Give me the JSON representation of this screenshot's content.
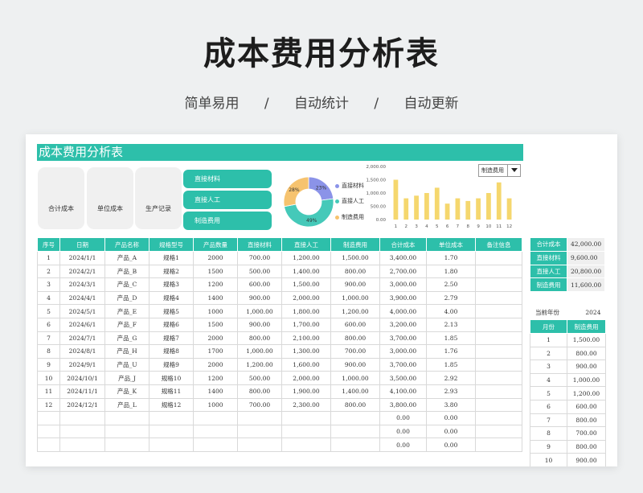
{
  "page": {
    "headline": "成本费用分析表",
    "tags": [
      "简单易用",
      "/",
      "自动统计",
      "/",
      "自动更新"
    ]
  },
  "sheet": {
    "banner_title": "成本费用分析表",
    "cards": [
      "合计成本",
      "单位成本",
      "生产记录"
    ],
    "category_buttons": [
      "直接材料",
      "直接人工",
      "制造费用"
    ]
  },
  "donut": {
    "slices": [
      {
        "label": "直接材料",
        "percent": 23,
        "value_text": "23%",
        "color": "#8b93e8"
      },
      {
        "label": "直接人工",
        "percent": 49,
        "value_text": "49%",
        "color": "#45c9b9"
      },
      {
        "label": "制造费用",
        "percent": 28,
        "value_text": "28%",
        "color": "#f6c36f"
      }
    ]
  },
  "chart_data": {
    "type": "bar",
    "categories": [
      "1",
      "2",
      "3",
      "4",
      "5",
      "6",
      "7",
      "8",
      "9",
      "10",
      "11",
      "12"
    ],
    "values": [
      1500,
      800,
      900,
      1000,
      1200,
      600,
      800,
      700,
      800,
      1000,
      1400,
      800
    ],
    "ylim": [
      0,
      2000
    ],
    "yticks": [
      "2,000.00",
      "1,500.00",
      "1,000.00",
      "500.00",
      "0.00"
    ],
    "bar_color": "#f5d76e",
    "selector_value": "制造费用",
    "title": "",
    "xlabel": "",
    "ylabel": ""
  },
  "main_table": {
    "headers": [
      "序号",
      "日期",
      "产品名称",
      "规格型号",
      "产品数量",
      "直接材料",
      "直接人工",
      "制造费用",
      "合计成本",
      "单位成本",
      "备注信息"
    ],
    "rows": [
      [
        "1",
        "2024/1/1",
        "产品_A",
        "规格1",
        "2000",
        "700.00",
        "1,200.00",
        "1,500.00",
        "3,400.00",
        "1.70",
        ""
      ],
      [
        "2",
        "2024/2/1",
        "产品_B",
        "规格2",
        "1500",
        "500.00",
        "1,400.00",
        "800.00",
        "2,700.00",
        "1.80",
        ""
      ],
      [
        "3",
        "2024/3/1",
        "产品_C",
        "规格3",
        "1200",
        "600.00",
        "1,500.00",
        "900.00",
        "3,000.00",
        "2.50",
        ""
      ],
      [
        "4",
        "2024/4/1",
        "产品_D",
        "规格4",
        "1400",
        "900.00",
        "2,000.00",
        "1,000.00",
        "3,900.00",
        "2.79",
        ""
      ],
      [
        "5",
        "2024/5/1",
        "产品_E",
        "规格5",
        "1000",
        "1,000.00",
        "1,800.00",
        "1,200.00",
        "4,000.00",
        "4.00",
        ""
      ],
      [
        "6",
        "2024/6/1",
        "产品_F",
        "规格6",
        "1500",
        "900.00",
        "1,700.00",
        "600.00",
        "3,200.00",
        "2.13",
        ""
      ],
      [
        "7",
        "2024/7/1",
        "产品_G",
        "规格7",
        "2000",
        "800.00",
        "2,100.00",
        "800.00",
        "3,700.00",
        "1.85",
        ""
      ],
      [
        "8",
        "2024/8/1",
        "产品_H",
        "规格8",
        "1700",
        "1,000.00",
        "1,300.00",
        "700.00",
        "3,000.00",
        "1.76",
        ""
      ],
      [
        "9",
        "2024/9/1",
        "产品_U",
        "规格9",
        "2000",
        "1,200.00",
        "1,600.00",
        "900.00",
        "3,700.00",
        "1.85",
        ""
      ],
      [
        "10",
        "2024/10/1",
        "产品_J",
        "规格10",
        "1200",
        "500.00",
        "2,000.00",
        "1,000.00",
        "3,500.00",
        "2.92",
        ""
      ],
      [
        "11",
        "2024/11/1",
        "产品_K",
        "规格11",
        "1400",
        "800.00",
        "1,900.00",
        "1,400.00",
        "4,100.00",
        "2.93",
        ""
      ],
      [
        "12",
        "2024/12/1",
        "产品_L",
        "规格12",
        "1000",
        "700.00",
        "2,300.00",
        "800.00",
        "3,800.00",
        "3.80",
        ""
      ],
      [
        "",
        "",
        "",
        "",
        "",
        "",
        "",
        "",
        "0.00",
        "0.00",
        ""
      ],
      [
        "",
        "",
        "",
        "",
        "",
        "",
        "",
        "",
        "0.00",
        "0.00",
        ""
      ],
      [
        "",
        "",
        "",
        "",
        "",
        "",
        "",
        "",
        "0.00",
        "0.00",
        ""
      ]
    ]
  },
  "summary": [
    {
      "label": "合计成本",
      "value": "42,000.00"
    },
    {
      "label": "直接材料",
      "value": "9,600.00"
    },
    {
      "label": "直接人工",
      "value": "20,800.00"
    },
    {
      "label": "制造费用",
      "value": "11,600.00"
    }
  ],
  "year_selector": {
    "label": "当前年份",
    "value": "2024"
  },
  "monthly_table": {
    "headers": [
      "月份",
      "制造费用"
    ],
    "rows": [
      [
        "1",
        "1,500.00"
      ],
      [
        "2",
        "800.00"
      ],
      [
        "3",
        "900.00"
      ],
      [
        "4",
        "1,000.00"
      ],
      [
        "5",
        "1,200.00"
      ],
      [
        "6",
        "600.00"
      ],
      [
        "7",
        "800.00"
      ],
      [
        "8",
        "700.00"
      ],
      [
        "9",
        "800.00"
      ],
      [
        "10",
        "900.00"
      ]
    ]
  }
}
